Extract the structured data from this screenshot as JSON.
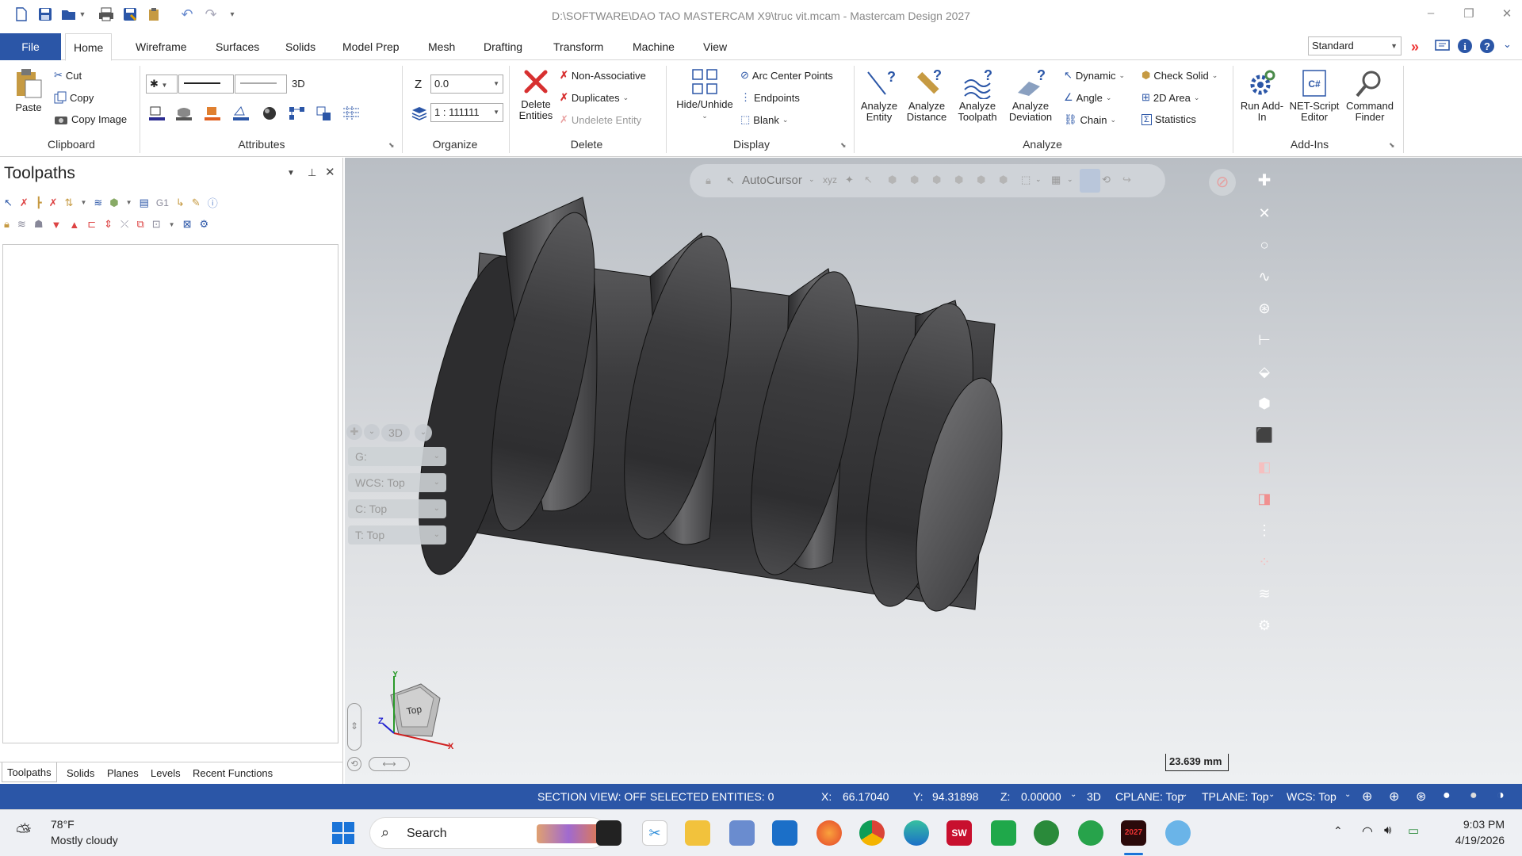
{
  "titlebar": {
    "title": "D:\\SOFTWARE\\DAO TAO MASTERCAM X9\\truc vit.mcam - Mastercam Design 2027"
  },
  "menu": {
    "file": "File",
    "tabs": [
      "Home",
      "Wireframe",
      "Surfaces",
      "Solids",
      "Model Prep",
      "Mesh",
      "Drafting",
      "Transform",
      "Machine",
      "View"
    ],
    "standard": "Standard"
  },
  "ribbon": {
    "clipboard": {
      "paste": "Paste",
      "cut": "Cut",
      "copy": "Copy",
      "copy_image": "Copy Image",
      "label": "Clipboard"
    },
    "attributes": {
      "mode": "3D",
      "label": "Attributes"
    },
    "organize": {
      "z_label": "Z",
      "z_value": "0.0",
      "scale": "1 : 111111",
      "label": "Organize"
    },
    "delete": {
      "delete_entities": "Delete Entities",
      "non_associative": "Non-Associative",
      "duplicates": "Duplicates",
      "undelete": "Undelete Entity",
      "label": "Delete"
    },
    "display": {
      "hide_unhide": "Hide/Unhide",
      "arc_center": "Arc Center Points",
      "endpoints": "Endpoints",
      "blank": "Blank",
      "label": "Display"
    },
    "analyze": {
      "entity": "Analyze Entity",
      "distance": "Analyze Distance",
      "toolpath": "Analyze Toolpath",
      "deviation": "Analyze Deviation",
      "dynamic": "Dynamic",
      "angle": "Angle",
      "chain": "Chain",
      "check_solid": "Check Solid",
      "area_2d": "2D Area",
      "statistics": "Statistics",
      "label": "Analyze"
    },
    "addins": {
      "run": "Run Add-In",
      "net_script": "NET-Script Editor",
      "command_finder": "Command Finder",
      "label": "Add-Ins"
    }
  },
  "panel": {
    "title": "Toolpaths",
    "bottom_tabs": [
      "Toolpaths",
      "Solids",
      "Planes",
      "Levels",
      "Recent Functions"
    ]
  },
  "viewport": {
    "autocursor": "AutoCursor",
    "mode": "3D",
    "g": "G:",
    "wcs": "WCS:  Top",
    "c": "C:  Top",
    "t": "T:  Top",
    "cube_face": "Top",
    "axis_x": "X",
    "axis_y": "Y",
    "axis_z": "Z",
    "scale": "23.639 mm"
  },
  "status": {
    "section_view": "SECTION VIEW: OFF",
    "selected": "SELECTED ENTITIES: 0",
    "x_label": "X:",
    "x_value": "66.17040",
    "y_label": "Y:",
    "y_value": "94.31898",
    "z_label": "Z:",
    "z_value": "0.00000",
    "mode": "3D",
    "cplane": "CPLANE: Top",
    "tplane": "TPLANE: Top",
    "wcs": "WCS: Top"
  },
  "taskbar": {
    "temp": "78°F",
    "weather": "Mostly cloudy",
    "search": "Search",
    "time": "9:03 PM",
    "date": "4/19/2026"
  }
}
